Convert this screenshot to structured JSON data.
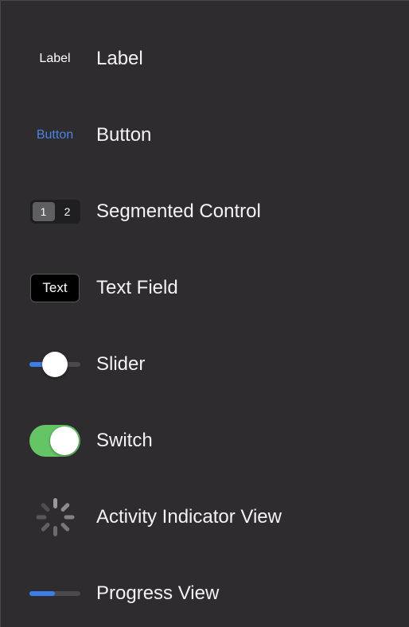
{
  "library": {
    "items": [
      {
        "name": "Label",
        "thumb_text": "Label"
      },
      {
        "name": "Button",
        "thumb_text": "Button"
      },
      {
        "name": "Segmented Control",
        "segments": [
          "1",
          "2"
        ],
        "selected_segment": 0
      },
      {
        "name": "Text Field",
        "thumb_text": "Text"
      },
      {
        "name": "Slider",
        "value": 0.5
      },
      {
        "name": "Switch",
        "state": "on"
      },
      {
        "name": "Activity Indicator View"
      },
      {
        "name": "Progress View",
        "progress": 0.5
      }
    ]
  },
  "colors": {
    "background": "#2e2c2f",
    "text": "#f3f3f3",
    "accent_blue": "#3d7de8",
    "button_blue": "#4c84e6",
    "switch_green": "#65c466"
  }
}
